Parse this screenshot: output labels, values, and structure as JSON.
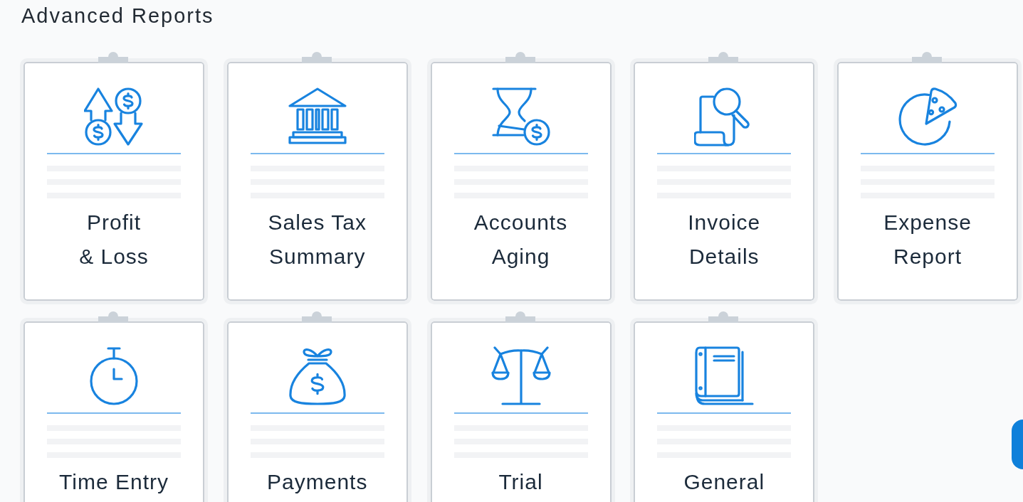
{
  "page": {
    "title": "Advanced Reports"
  },
  "reports": [
    {
      "label": "Profit\n& Loss"
    },
    {
      "label": "Sales Tax\nSummary"
    },
    {
      "label": "Accounts\nAging"
    },
    {
      "label": "Invoice\nDetails"
    },
    {
      "label": "Expense\nReport"
    },
    {
      "label": "Time Entry"
    },
    {
      "label": "Payments"
    },
    {
      "label": "Trial"
    },
    {
      "label": "General"
    }
  ]
}
